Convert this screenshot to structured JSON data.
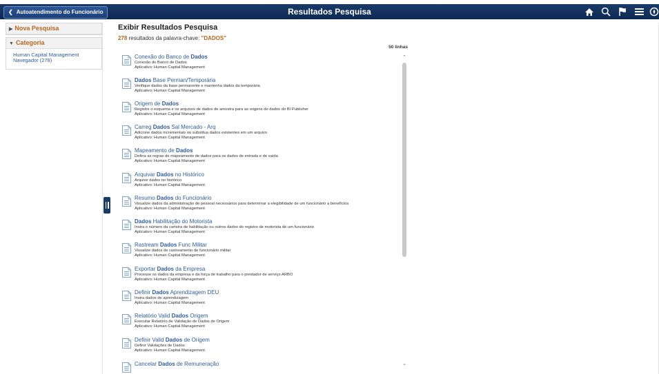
{
  "header": {
    "back_label": "Autoatendimento do Funcionário",
    "title": "Resultados Pesquisa",
    "icons": [
      "home-icon",
      "search-icon",
      "flag-icon",
      "menu-icon",
      "navbar-icon"
    ]
  },
  "sidebar": {
    "new_search": "Nova Pesquisa",
    "category_heading": "Categoria",
    "category_link": "Human Capital Management Navegador (278)"
  },
  "main": {
    "heading": "Exibir Resultados Pesquisa",
    "result_count": "278",
    "summary_text": " resultados da palavra-chave: ",
    "keyword": "\"DADOS\"",
    "rows_label": "50 linhas"
  },
  "results": [
    {
      "t_pre": "Conexão do Banco de ",
      "t_key": "Dados",
      "t_post": "",
      "desc": "Conexão do Banco de Dados",
      "app": "Aplicativo: Human Capital Management"
    },
    {
      "t_pre": "",
      "t_key": "Dados",
      "t_post": " Base Perman/Temporária",
      "desc": "Verifique dados da base permanente e mantenha dados da temporária",
      "app": "Aplicativo: Human Capital Management"
    },
    {
      "t_pre": "Origem de ",
      "t_key": "Dados",
      "t_post": "",
      "desc": "Registre o esquema e os arquivos de dados de amostra para as origens de dados do BI Publisher",
      "app": "Aplicativo: Human Capital Management"
    },
    {
      "t_pre": "Carreg ",
      "t_key": "Dados",
      "t_post": " Sal Mercado - Arq",
      "desc": "Adicione dados incrementais ou substitua dados existentes em um arquivo",
      "app": "Aplicativo: Human Capital Management"
    },
    {
      "t_pre": "Mapeamento de ",
      "t_key": "Dados",
      "t_post": "",
      "desc": "Defina as regras de mapeamento de dados para os dados de entrada e de saída",
      "app": "Aplicativo: Human Capital Management"
    },
    {
      "t_pre": "Arquivar ",
      "t_key": "Dados",
      "t_post": " no Histórico",
      "desc": "Arquive dados no histórico",
      "app": "Aplicativo: Human Capital Management"
    },
    {
      "t_pre": "Resumo ",
      "t_key": "Dados",
      "t_post": " do Funcionário",
      "desc": "Visualize dados da administração de pessoal necessários para determinar a elegibilidade de um funcionário a benefícios",
      "app": "Aplicativo: Human Capital Management"
    },
    {
      "t_pre": "",
      "t_key": "Dados",
      "t_post": " Habilitação do Motorista",
      "desc": "Insira o número da carteira de habilitação ou outros dados do registro de motorista de um funcionário",
      "app": "Aplicativo: Human Capital Management"
    },
    {
      "t_pre": "Rastream ",
      "t_key": "Dados",
      "t_post": " Func Militar",
      "desc": "Visualize dados de rastreamento de funcionário militar",
      "app": "Aplicativo: Human Capital Management"
    },
    {
      "t_pre": "Exportar ",
      "t_key": "Dados",
      "t_post": " da Empresa",
      "desc": "Processe os dados da empresa e da força de trabalho para o prestador de serviço ARBO",
      "app": "Aplicativo: Human Capital Management"
    },
    {
      "t_pre": "Definir ",
      "t_key": "Dados",
      "t_post": " Aprendizagem DEU",
      "desc": "Insira dados de aprendizagem",
      "app": "Aplicativo: Human Capital Management"
    },
    {
      "t_pre": "Relatório Valid ",
      "t_key": "Dados",
      "t_post": " Origem",
      "desc": "Executar Relatório de Validação de Dados de Origem",
      "app": "Aplicativo: Human Capital Management"
    },
    {
      "t_pre": "Definir Valid ",
      "t_key": "Dados",
      "t_post": " de Origem",
      "desc": "Definir Validações de Dados",
      "app": "Aplicativo: Human Capital Management"
    },
    {
      "t_pre": "Cancelar ",
      "t_key": "Dados",
      "t_post": " de Remuneração",
      "desc": "",
      "app": ""
    }
  ]
}
